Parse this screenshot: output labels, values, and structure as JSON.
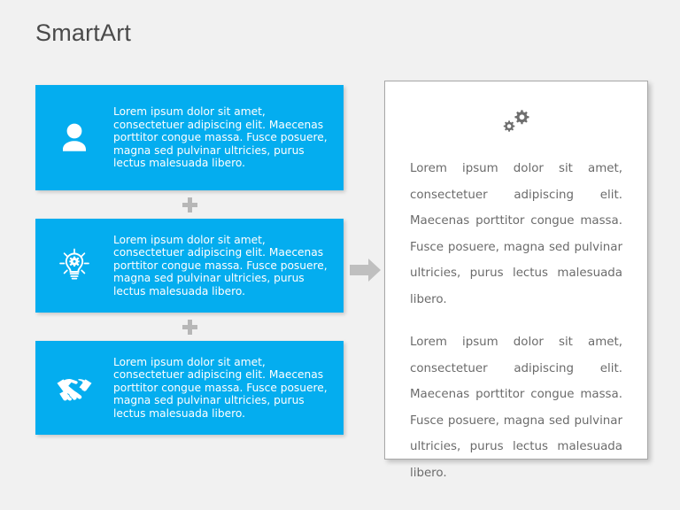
{
  "page": {
    "title": "SmartArt",
    "background_color": "#f1f1f1",
    "accent_color": "#04ADEF",
    "text_gray": "#6b6b6b",
    "connector_gray": "#b7b7b7"
  },
  "left_column": {
    "cards": [
      {
        "icon": "person-icon",
        "text": "Lorem ipsum dolor sit amet, consectetuer adipiscing elit. Maecenas porttitor congue massa. Fusce posuere, magna sed pulvinar ultricies, purus lectus malesuada libero."
      },
      {
        "icon": "lightbulb-gear-icon",
        "text": "Lorem ipsum dolor sit amet, consectetuer adipiscing elit. Maecenas porttitor congue massa. Fusce posuere, magna sed pulvinar ultricies, purus lectus malesuada libero."
      },
      {
        "icon": "handshake-icon",
        "text": "Lorem ipsum dolor sit amet, consectetuer adipiscing elit. Maecenas porttitor congue massa. Fusce posuere, magna sed pulvinar ultricies, purus lectus malesuada libero."
      }
    ],
    "connectors": [
      {
        "icon": "plus-icon"
      },
      {
        "icon": "plus-icon"
      }
    ]
  },
  "flow": {
    "arrow": {
      "icon": "right-arrow-icon",
      "color": "#bfbfbf"
    }
  },
  "panel": {
    "icon": "gears-icon",
    "paragraphs": [
      "Lorem ipsum dolor sit amet, consectetuer adipiscing elit. Maecenas porttitor congue massa. Fusce posuere, magna sed pulvinar ultricies, purus lectus malesuada libero.",
      "Lorem ipsum dolor sit amet, consectetuer adipiscing elit. Maecenas porttitor congue massa. Fusce posuere, magna sed pulvinar ultricies, purus lectus malesuada libero."
    ]
  }
}
